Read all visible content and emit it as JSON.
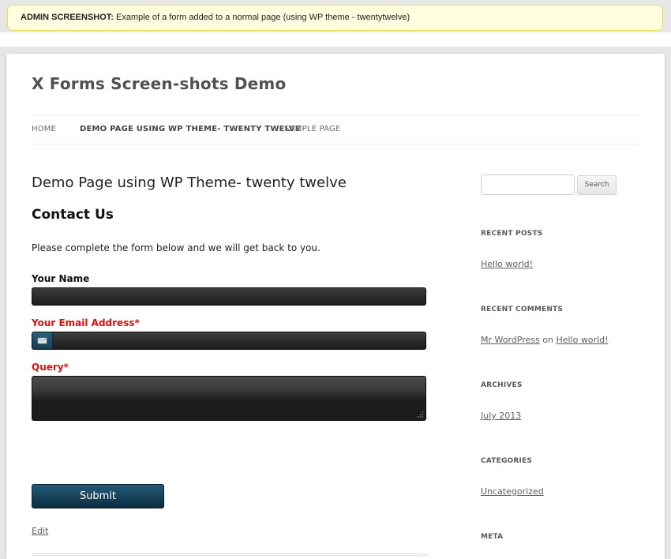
{
  "notice": {
    "label": "ADMIN SCREENSHOT:",
    "text": "Example of a form added to a normal page (using WP theme - twentytwelve)"
  },
  "site": {
    "title": "X Forms Screen-shots Demo"
  },
  "nav": {
    "items": [
      {
        "label": "HOME"
      },
      {
        "label": "DEMO PAGE USING WP THEME- TWENTY TWELVE"
      },
      {
        "label": "SAMPLE PAGE"
      }
    ]
  },
  "content": {
    "entry_title": "Demo Page using WP Theme- twenty twelve",
    "form_heading": "Contact Us",
    "intro": "Please complete the form below and we will get back to you.",
    "fields": {
      "name_label": "Your Name",
      "email_label": "Your Email Address",
      "query_label": "Query",
      "required_mark": "*",
      "name_value": "",
      "email_value": "",
      "query_value": ""
    },
    "submit_label": "Submit",
    "edit_label": "Edit"
  },
  "sidebar": {
    "search_button": "Search",
    "search_value": "",
    "recent_posts_title": "RECENT POSTS",
    "recent_posts": [
      "Hello world!"
    ],
    "recent_comments_title": "RECENT COMMENTS",
    "comment_author": "Mr WordPress",
    "comment_on": "on",
    "comment_post": "Hello world!",
    "archives_title": "ARCHIVES",
    "archives": [
      "July 2013"
    ],
    "categories_title": "CATEGORIES",
    "categories": [
      "Uncategorized"
    ],
    "meta_title": "META"
  },
  "colors": {
    "required": "#e00d0d",
    "submit_bg": "#0b2c40",
    "notice_bg": "#ffffe0"
  }
}
